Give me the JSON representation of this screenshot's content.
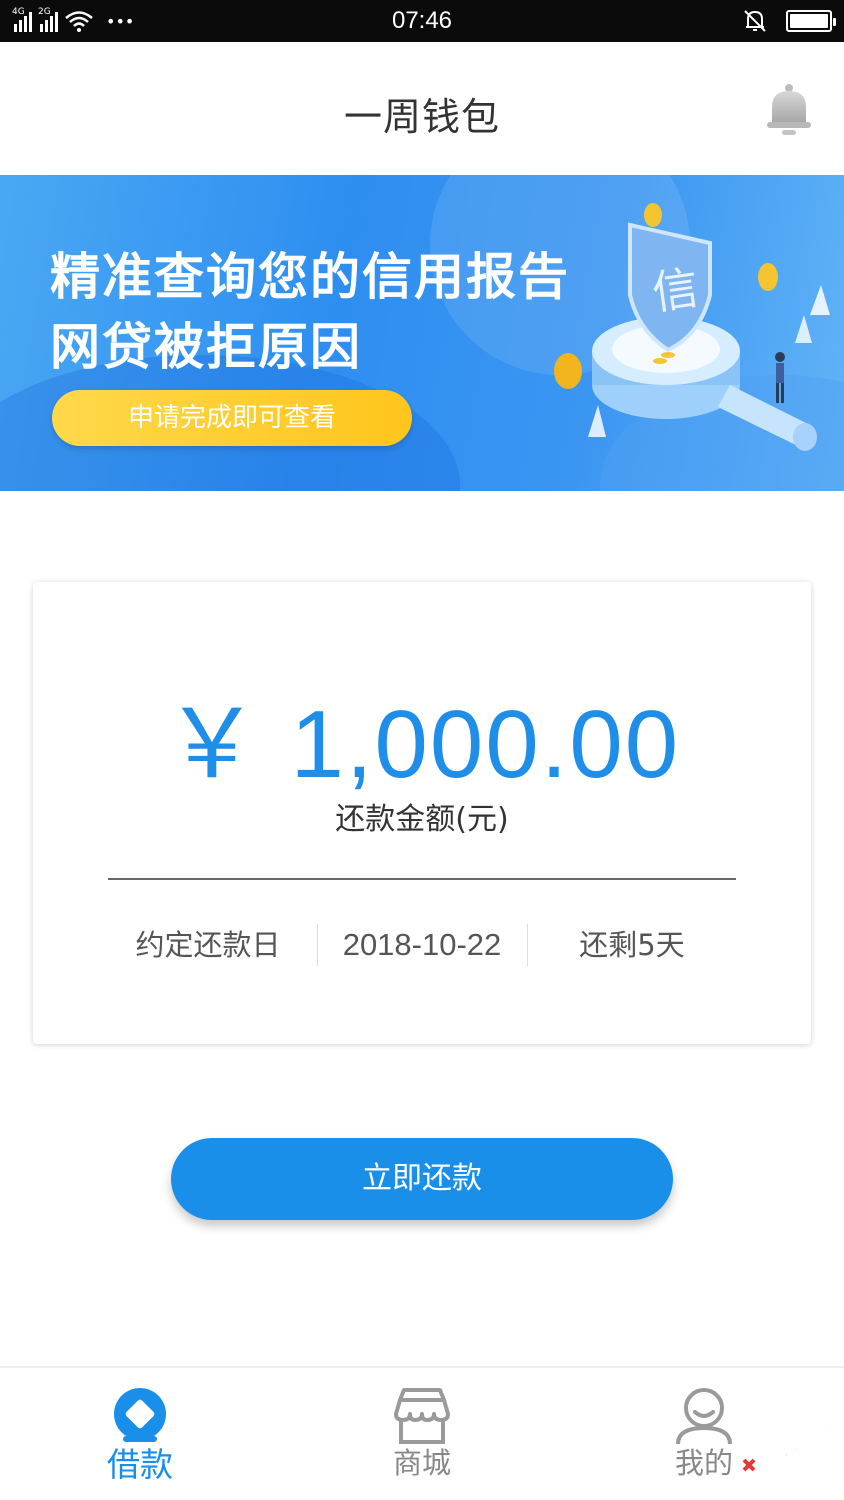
{
  "status_bar": {
    "signal_1_tag": "4G",
    "signal_2_tag": "2G",
    "more": "•••",
    "time": "07:46",
    "icons": [
      "signal-4g-icon",
      "signal-2g-icon",
      "wifi-icon",
      "notification-muted-icon",
      "battery-icon"
    ]
  },
  "header": {
    "title": "一周钱包",
    "bell_icon": "bell-icon"
  },
  "banner": {
    "line1": "精准查询您的信用报告",
    "line2": "网贷被拒原因",
    "cta_label": "申请完成即可查看",
    "shield_char": "信"
  },
  "repayment_card": {
    "amount": "￥ 1,000.00",
    "amount_label": "还款金额(元)",
    "due_label": "约定还款日",
    "due_date": "2018-10-22",
    "remaining": "还剩5天"
  },
  "pay_button": {
    "label": "立即还款"
  },
  "bottom_nav": {
    "items": [
      {
        "label": "借款",
        "icon": "loan-icon",
        "active": true
      },
      {
        "label": "商城",
        "icon": "shop-icon",
        "active": false
      },
      {
        "label": "我的",
        "icon": "profile-icon",
        "active": false
      }
    ]
  },
  "watermark": {
    "text": "卡农社区"
  },
  "colors": {
    "primary": "#1a8fe9",
    "banner_blue": "#2e8ef0",
    "cta_yellow": "#ffc51c",
    "status_bar": "#0b0b0b"
  }
}
